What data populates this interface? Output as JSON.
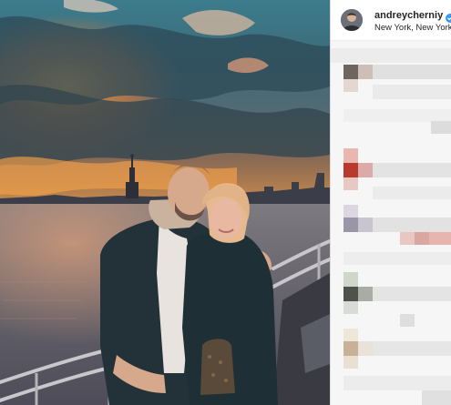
{
  "post": {
    "photo_icon": "photo",
    "author": {
      "username": "andreycherniy",
      "verified": true,
      "verified_icon": "verified-badge-icon",
      "location": "New York, New York"
    },
    "comments_pixelated": true
  },
  "colors": {
    "verified_blue": "#3897f0",
    "text": "#262626",
    "border": "#dbdbdb"
  }
}
